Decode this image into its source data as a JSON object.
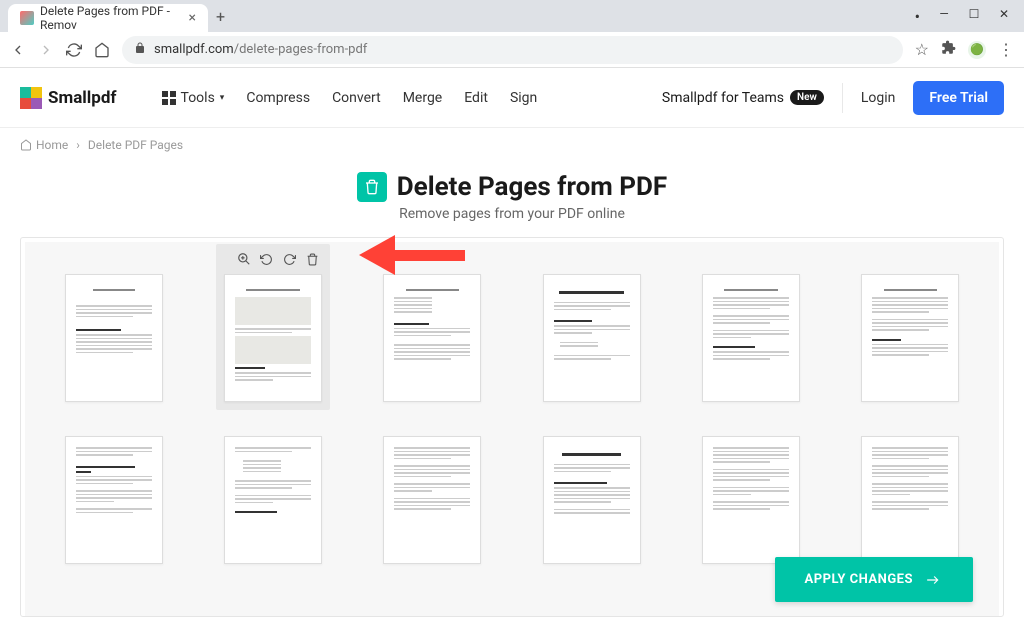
{
  "browser": {
    "tab_title": "Delete Pages from PDF - Remov",
    "new_tab": "+",
    "url_domain": "smallpdf.com",
    "url_path": "/delete-pages-from-pdf",
    "win": {
      "min": "—",
      "max": "☐",
      "close": "✕"
    }
  },
  "header": {
    "logo_text": "Smallpdf",
    "nav": {
      "tools": "Tools",
      "compress": "Compress",
      "convert": "Convert",
      "merge": "Merge",
      "edit": "Edit",
      "sign": "Sign"
    },
    "teams": "Smallpdf for Teams",
    "teams_badge": "New",
    "login": "Login",
    "free_trial": "Free Trial"
  },
  "breadcrumb": {
    "home": "Home",
    "sep": "›",
    "current": "Delete PDF Pages"
  },
  "page": {
    "title": "Delete Pages from PDF",
    "subtitle": "Remove pages from your PDF online"
  },
  "workspace": {
    "apply": "APPLY CHANGES",
    "thumb_tools": {
      "zoom": "⊕",
      "rotate_ccw": "↺",
      "rotate_cw": "↻",
      "delete": "🗑"
    }
  }
}
